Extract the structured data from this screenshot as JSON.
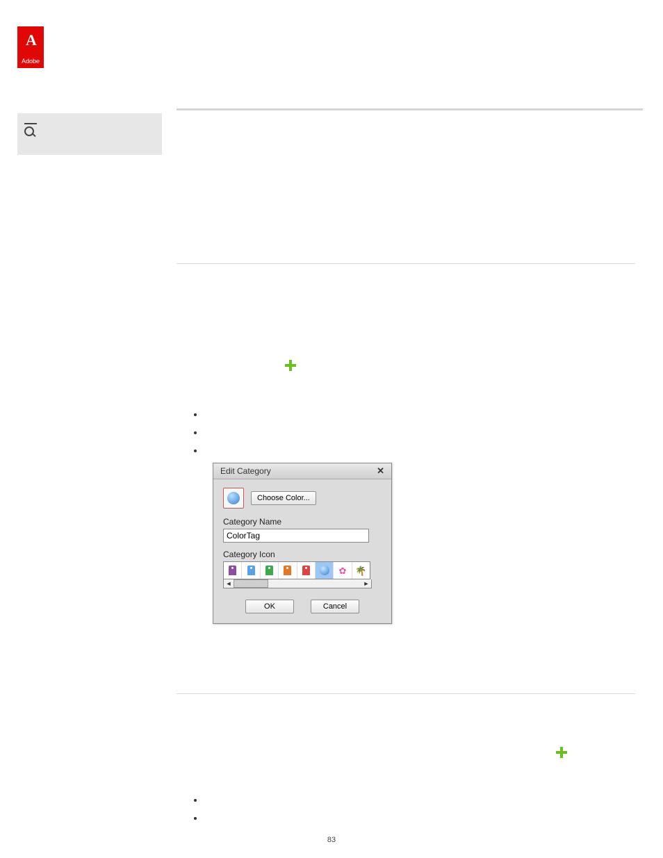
{
  "logo": {
    "mark": "A",
    "label": "Adobe"
  },
  "page_number": "83",
  "dialog": {
    "title": "Edit Category",
    "choose_color": "Choose Color...",
    "name_label": "Category Name",
    "name_value": "ColorTag",
    "icon_label": "Category Icon",
    "ok": "OK",
    "cancel": "Cancel",
    "icons": {
      "tag_colors": [
        "#8a4fa0",
        "#5aa0e6",
        "#3fa84a",
        "#e07a2a",
        "#d94545"
      ],
      "selected_index": 5
    }
  }
}
